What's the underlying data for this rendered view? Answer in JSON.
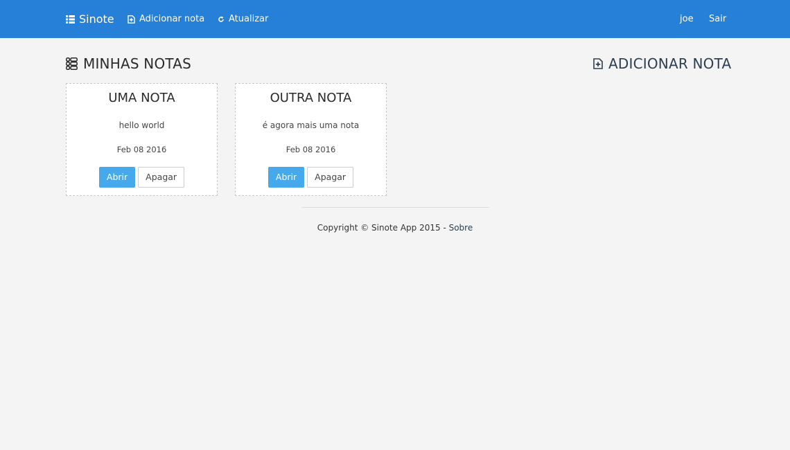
{
  "navbar": {
    "brand": "Sinote",
    "add_note": "Adicionar nota",
    "refresh": "Atualizar",
    "user": "joe",
    "logout": "Sair",
    "bg_color": "#2780d7"
  },
  "main": {
    "notes_heading": "MINHAS NOTAS",
    "add_heading": "ADICIONAR NOTA",
    "notes": [
      {
        "title": "UMA NOTA",
        "body": "hello world",
        "date": "Feb 08 2016",
        "open_label": "Abrir",
        "delete_label": "Apagar"
      },
      {
        "title": "OUTRA NOTA",
        "body": "é agora mais uma nota",
        "date": "Feb 08 2016",
        "open_label": "Abrir",
        "delete_label": "Apagar"
      }
    ]
  },
  "footer": {
    "copyright": "Copyright © Sinote App 2015 - ",
    "about_link": "Sobre"
  },
  "icons": {
    "brand": "list-icon",
    "add_note": "plus-file-icon",
    "refresh": "refresh-icon",
    "notes_heading": "list-alt-icon",
    "add_heading": "plus-file-icon"
  },
  "colors": {
    "primary_button": "#45a9ec",
    "page_bg": "#f4f4f4"
  }
}
